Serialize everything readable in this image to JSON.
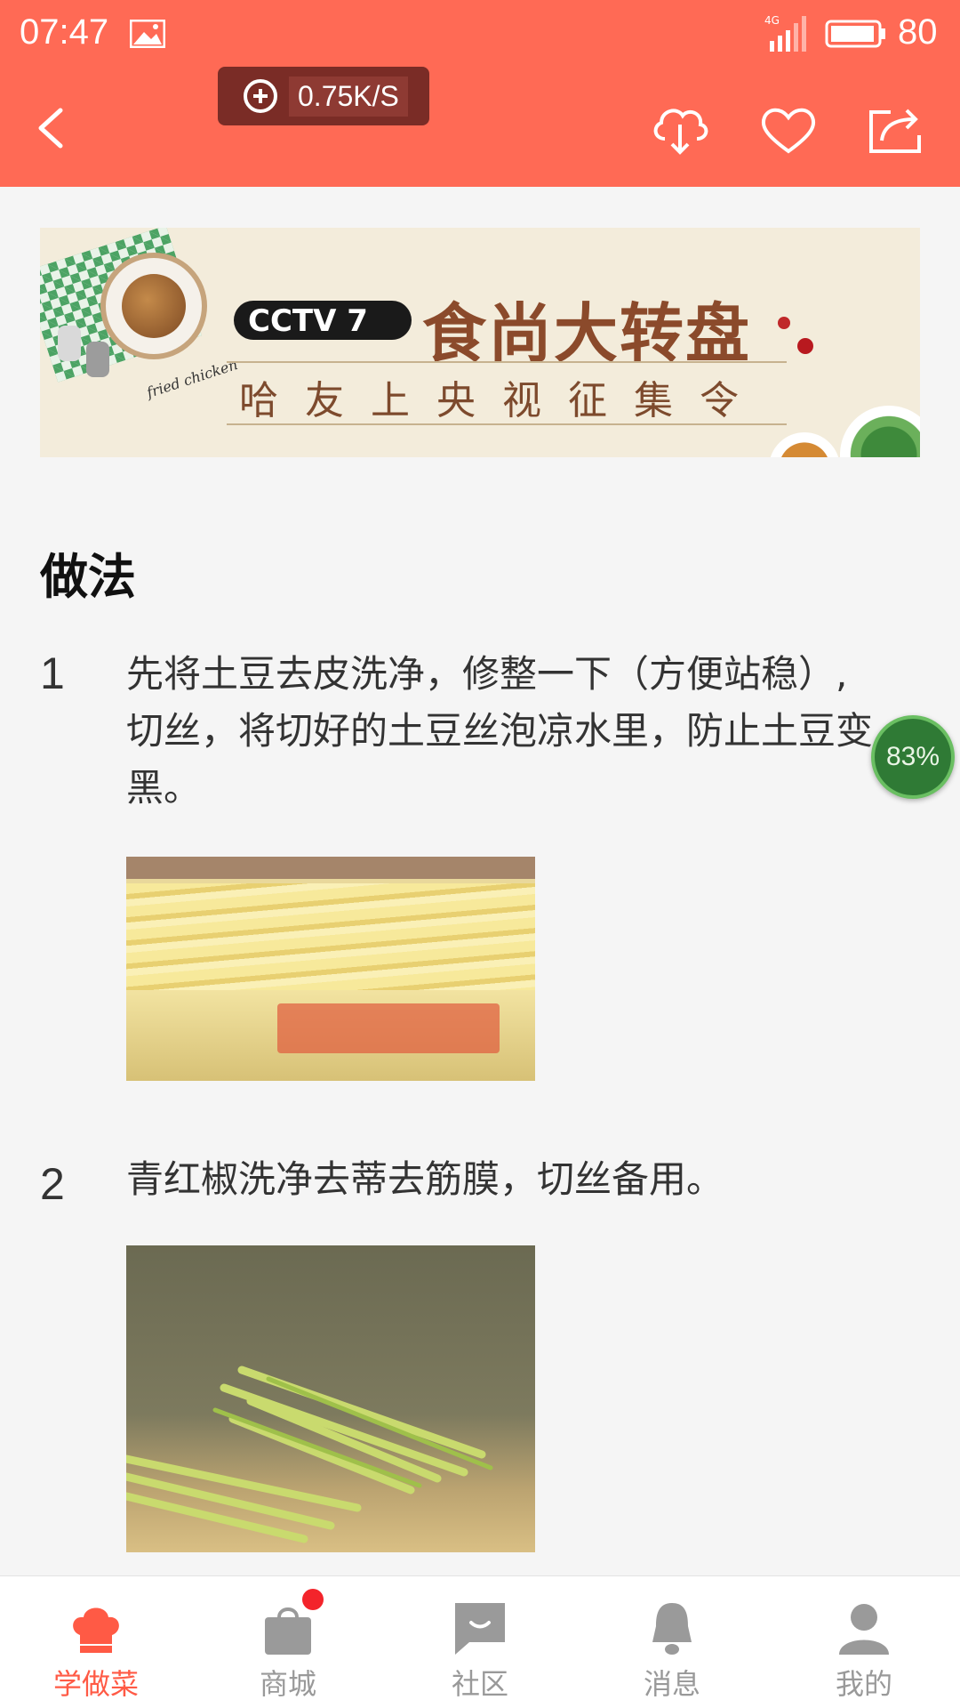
{
  "status": {
    "time": "07:47",
    "network": "4G",
    "battery": "80"
  },
  "download_speed": "0.75K/S",
  "banner": {
    "channel": "CCTV 7",
    "title": "食尚大转盘",
    "subtitle": "哈友上央视征集令",
    "decoration": "fried chicken"
  },
  "section_title": "做法",
  "steps": [
    {
      "num": "1",
      "text": "先将土豆去皮洗净，修整一下（方便站稳）, 切丝，将切好的土豆丝泡凉水里，防止土豆变黑。"
    },
    {
      "num": "2",
      "text": "青红椒洗净去蒂去筋膜，切丝备用。"
    }
  ],
  "float_percent": "83%",
  "nav": [
    {
      "label": "学做菜",
      "icon": "chef-hat-icon",
      "active": true
    },
    {
      "label": "商城",
      "icon": "shopping-bag-icon",
      "badge": true
    },
    {
      "label": "社区",
      "icon": "chat-icon"
    },
    {
      "label": "消息",
      "icon": "bell-icon"
    },
    {
      "label": "我的",
      "icon": "user-icon"
    }
  ],
  "colors": {
    "header": "#ff6a55",
    "accent": "#ff5a45",
    "nav_inactive": "#999999"
  }
}
